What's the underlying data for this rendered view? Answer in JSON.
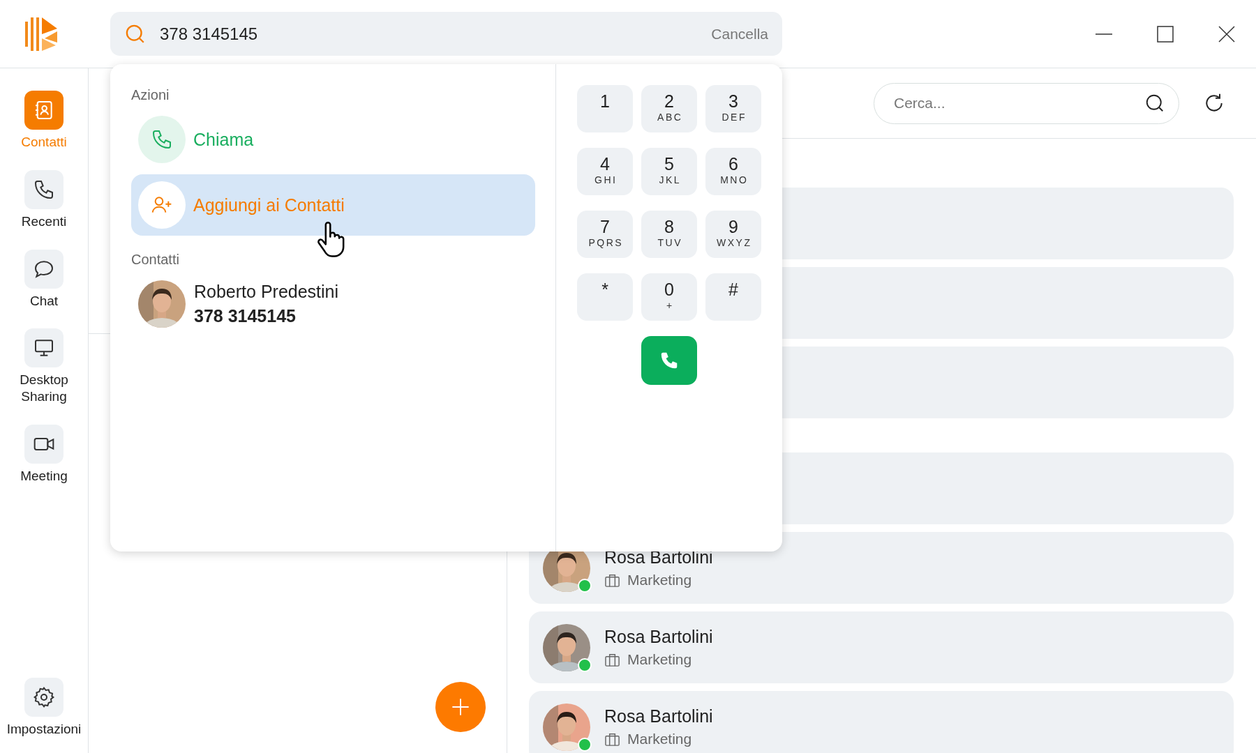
{
  "topbar": {
    "search": {
      "value": "378 3145145",
      "clear_label": "Cancella"
    }
  },
  "sidebar": {
    "items": [
      {
        "label": "Contatti",
        "kind": "contacts",
        "selected": true
      },
      {
        "label": "Recenti",
        "kind": "phone",
        "selected": false
      },
      {
        "label": "Chat",
        "kind": "chat",
        "selected": false
      },
      {
        "label": "Desktop Sharing",
        "kind": "monitor",
        "selected": false
      },
      {
        "label": "Meeting",
        "kind": "video",
        "selected": false
      }
    ],
    "settings": {
      "label": "Impostazioni",
      "selected": false
    }
  },
  "dropdown": {
    "actions_heading": "Azioni",
    "actions": [
      {
        "label": "Chiama",
        "kind": "call",
        "hovered": false
      },
      {
        "label": "Aggiungi ai Contatti",
        "kind": "add-contact",
        "hovered": true
      }
    ],
    "contacts_heading": "Contatti",
    "contacts": [
      {
        "name": "Roberto Predestini",
        "number": "378 3145145"
      }
    ],
    "keypad": [
      {
        "digit": "1"
      },
      {
        "digit": "2",
        "letters": "ABC"
      },
      {
        "digit": "3",
        "letters": "DEF"
      },
      {
        "digit": "4",
        "letters": "GHI"
      },
      {
        "digit": "5",
        "letters": "JKL"
      },
      {
        "digit": "6",
        "letters": "MNO"
      },
      {
        "digit": "7",
        "letters": "PQRS"
      },
      {
        "digit": "8",
        "letters": "TUV"
      },
      {
        "digit": "9",
        "letters": "WXYZ"
      },
      {
        "digit": "*"
      },
      {
        "digit": "0",
        "letters": "+"
      },
      {
        "digit": "#"
      }
    ]
  },
  "contacts_panel": {
    "search": {
      "placeholder": "Cerca..."
    },
    "groups": [
      {
        "cards": [
          {
            "kind": "covered"
          },
          {
            "kind": "covered"
          },
          {
            "kind": "covered"
          }
        ]
      },
      {
        "cards": [
          {
            "kind": "covered"
          },
          {
            "kind": "contact",
            "name": "Rosa Bartolini",
            "department": "Marketing",
            "online": true
          },
          {
            "kind": "contact",
            "name": "Rosa Bartolini",
            "department": "Marketing",
            "online": true
          },
          {
            "kind": "contact",
            "name": "Rosa Bartolini",
            "department": "Marketing",
            "online": true
          }
        ]
      }
    ]
  }
}
